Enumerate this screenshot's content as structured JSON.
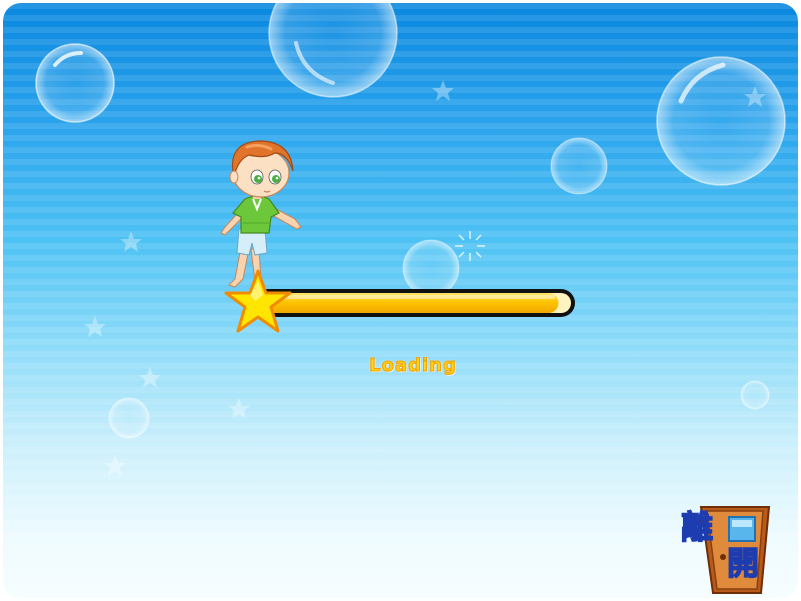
{
  "loading": {
    "label": "Loading",
    "progress": 0.96
  },
  "exit_button": {
    "char_1": "離",
    "char_2": "開"
  },
  "colors": {
    "sky_top": "#0a88df",
    "sky_bottom": "#f6fdff",
    "bar_fill": "#ffc400",
    "bar_border": "#111111",
    "star": "#ffe600",
    "loading_text": "#ffd21c",
    "exit_text": "#ffe800"
  },
  "icons": [
    "boy-character",
    "star-icon",
    "bubble",
    "door-icon"
  ]
}
